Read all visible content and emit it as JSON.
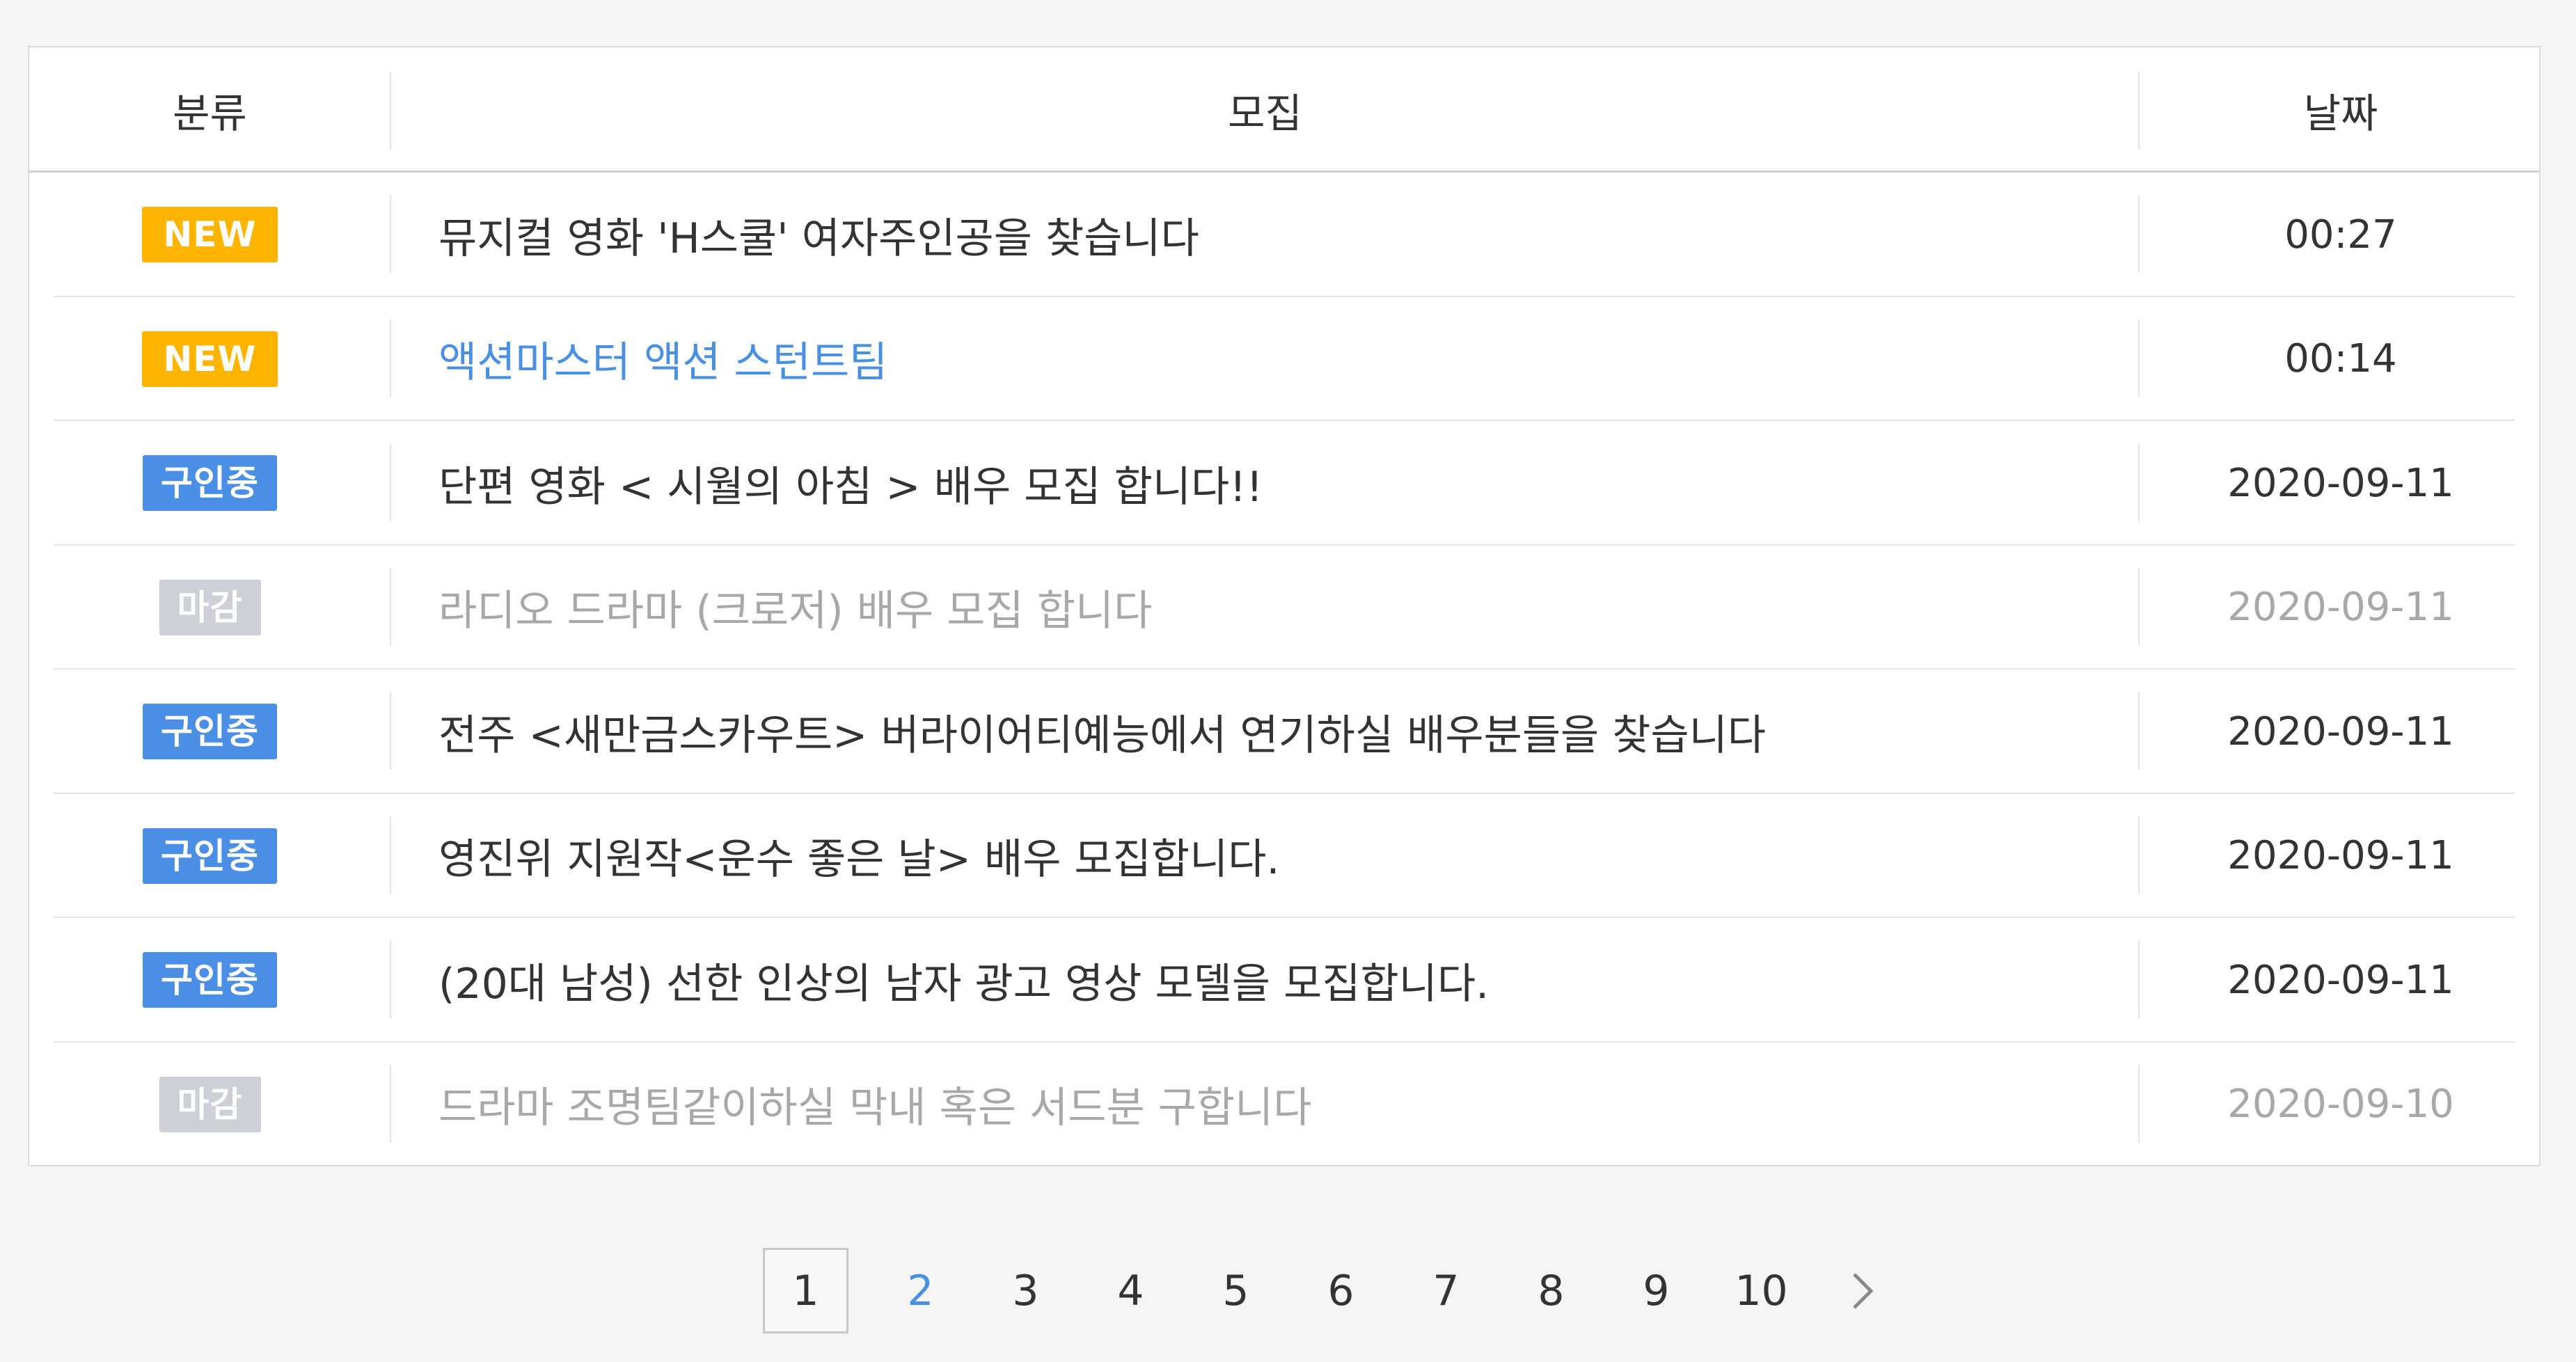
{
  "table": {
    "headers": {
      "category": "분류",
      "title": "모집",
      "date": "날짜"
    },
    "rows": [
      {
        "badge": "NEW",
        "badge_type": "new",
        "title": "뮤지컬 영화 'H스쿨' 여자주인공을 찾습니다",
        "date": "00:27",
        "state": "normal"
      },
      {
        "badge": "NEW",
        "badge_type": "new",
        "title": "액션마스터 액션 스턴트팀",
        "date": "00:14",
        "state": "highlight"
      },
      {
        "badge": "구인중",
        "badge_type": "hiring",
        "title": "단편 영화 < 시월의 아침 > 배우 모집 합니다!!",
        "date": "2020-09-11",
        "state": "normal"
      },
      {
        "badge": "마감",
        "badge_type": "closed",
        "title": "라디오 드라마 (크로저) 배우 모집 합니다",
        "date": "2020-09-11",
        "state": "muted"
      },
      {
        "badge": "구인중",
        "badge_type": "hiring",
        "title": "전주 <새만금스카우트> 버라이어티예능에서 연기하실 배우분들을 찾습니다",
        "date": "2020-09-11",
        "state": "normal"
      },
      {
        "badge": "구인중",
        "badge_type": "hiring",
        "title": "영진위 지원작<운수 좋은 날> 배우 모집합니다.",
        "date": "2020-09-11",
        "state": "normal"
      },
      {
        "badge": "구인중",
        "badge_type": "hiring",
        "title": "(20대 남성) 선한 인상의 남자 광고 영상 모델을 모집합니다.",
        "date": "2020-09-11",
        "state": "normal"
      },
      {
        "badge": "마감",
        "badge_type": "closed",
        "title": "드라마 조명팀같이하실 막내 혹은 서드분 구합니다",
        "date": "2020-09-10",
        "state": "muted"
      }
    ]
  },
  "pagination": {
    "pages": [
      "1",
      "2",
      "3",
      "4",
      "5",
      "6",
      "7",
      "8",
      "9",
      "10"
    ],
    "current": "1",
    "next_icon": "chevron-right-icon"
  },
  "colors": {
    "new_badge": "#ffb400",
    "hiring_badge": "#4a8ee6",
    "closed_badge": "#cdd0d6",
    "link_highlight": "#4a90e2",
    "muted_text": "#a8a8a8"
  }
}
